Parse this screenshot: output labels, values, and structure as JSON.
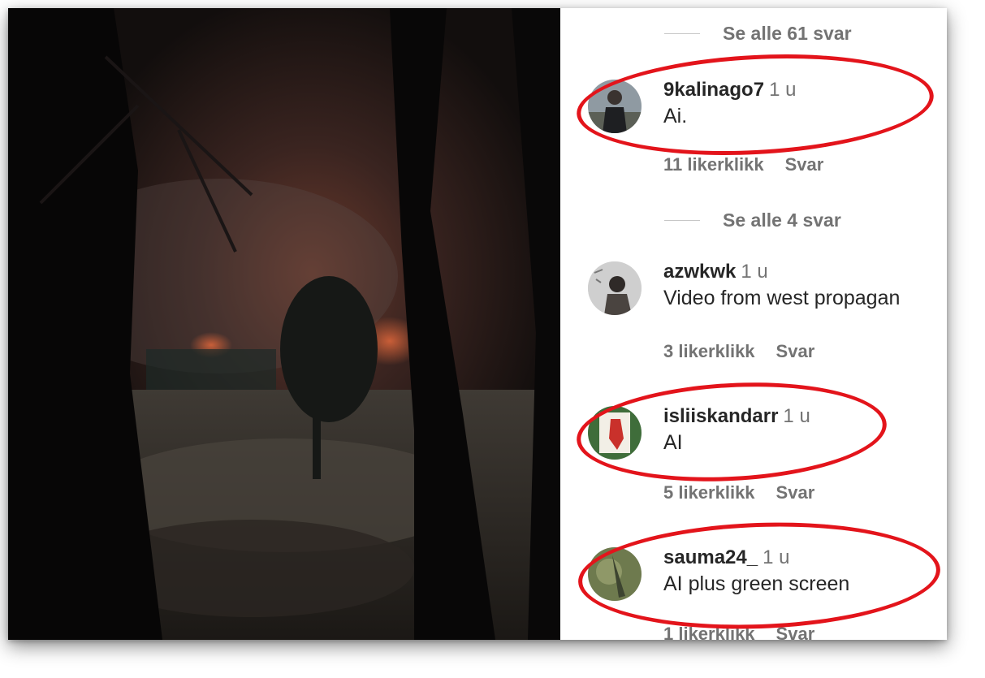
{
  "comments_panel": {
    "see_all_1": "Se alle 61 svar",
    "see_all_2": "Se alle 4 svar",
    "comments": [
      {
        "username": "9kalinago7",
        "time": "1 u",
        "text": "Ai.",
        "likes": "11 likerklikk",
        "reply": "Svar"
      },
      {
        "username": "azwkwk",
        "time": "1 u",
        "text": "Video from west propagan",
        "likes": "3 likerklikk",
        "reply": "Svar"
      },
      {
        "username": "isliiskandarr",
        "time": "1 u",
        "text": "AI",
        "likes": "5 likerklikk",
        "reply": "Svar"
      },
      {
        "username": "sauma24_",
        "time": "1 u",
        "text": "AI plus green screen",
        "likes": "1 likerklikk",
        "reply": "Svar"
      }
    ]
  },
  "colors": {
    "highlight_ring": "#e3141b",
    "secondary_text": "#737373",
    "primary_text": "#262626"
  }
}
